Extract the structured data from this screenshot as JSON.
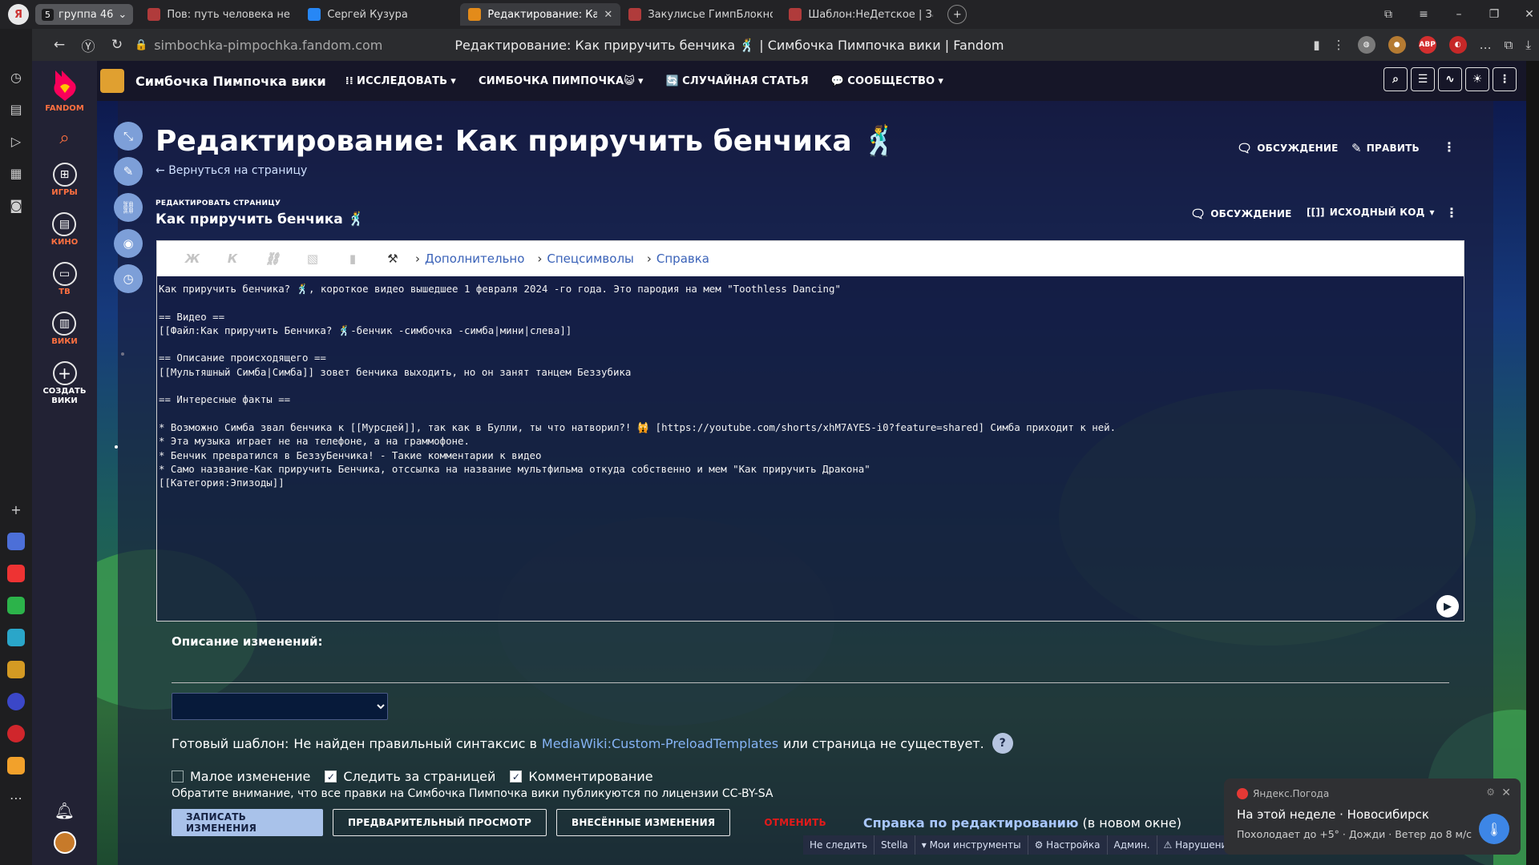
{
  "browser": {
    "group_label": "группа 46",
    "group_count": "5",
    "tabs": [
      {
        "label": "Пов: путь человека не чи",
        "active": false,
        "color": "#b03b3b"
      },
      {
        "label": "Сергей Кузура",
        "active": false,
        "color": "#2787f5"
      },
      {
        "label": "Редактирование: Как п",
        "active": true,
        "color": "#e38b1a"
      },
      {
        "label": "Закулисье ГимпБлокнота",
        "active": false,
        "color": "#b03b3b"
      },
      {
        "label": "Шаблон:НеДетское | Заку",
        "active": false,
        "color": "#b03b3b"
      }
    ],
    "url_host": "simbochka-pimpochka.fandom.com",
    "page_title": "Редактирование: Как приручить бенчика 🕺 | Симбочка Пимпочка вики | Fandom",
    "ext_abp": "ABP"
  },
  "fandom_rail": {
    "logo": "FANDOM",
    "items": [
      {
        "label": "ИГРЫ",
        "icon": "gamepad-icon"
      },
      {
        "label": "КИНО",
        "icon": "clapperboard-icon"
      },
      {
        "label": "ТВ",
        "icon": "tv-icon"
      },
      {
        "label": "ВИКИ",
        "icon": "book-icon"
      },
      {
        "label": "СОЗДАТЬ ВИКИ",
        "icon": "plus-icon"
      }
    ]
  },
  "wiki_header": {
    "name": "Симбочка Пимпочка вики",
    "nav": [
      {
        "label": "ИССЛЕДОВАТЬ",
        "prefix": "⁞⁞",
        "dropdown": true
      },
      {
        "label": "СИМБОЧКА ПИМПОЧКА😺",
        "prefix": "",
        "dropdown": true
      },
      {
        "label": "СЛУЧАЙНАЯ СТАТЬЯ",
        "prefix": "🔄",
        "dropdown": false
      },
      {
        "label": "СООБЩЕСТВО",
        "prefix": "💬",
        "dropdown": true
      }
    ]
  },
  "page": {
    "title": "Редактирование: Как приручить бенчика 🕺",
    "back_link": "Вернуться на страницу",
    "discussion": "ОБСУЖДЕНИЕ",
    "edit": "ПРАВИТЬ",
    "edit_label": "РЕДАКТИРОВАТЬ СТРАНИЦУ",
    "edit_subject": "Как приручить бенчика 🕺",
    "discussion2": "ОБСУЖДЕНИЕ",
    "source_code": "ИСХОДНЫЙ КОД"
  },
  "editor": {
    "toolbar": {
      "bold": "Ж",
      "italic": "К",
      "more": "Дополнительно",
      "special": "Спецсимволы",
      "help": "Справка"
    },
    "text": "Как приручить бенчика? 🕺, короткое видео вышедшее 1 февраля 2024 -го года. Это пародия на мем \"Toothless Dancing\"\n\n== Видео ==\n[[Файл:Как приручить Бенчика? 🕺-бенчик -симбочка -симба|мини|слева]]\n\n== Описание происходящего ==\n[[Мультяшный Симба|Симба]] зовет бенчика выходить, но он занят танцем Беззубика\n\n== Интересные факты ==\n\n* Возможно Симба звал бенчика к [[Мурсдей]], так как в Булли, ты что натворил?! 🙀 [https://youtube.com/shorts/xhM7AYES-i0?feature=shared] Симба приходит к ней.\n* Эта музыка играет не на телефоне, а на граммофоне.\n* Бенчик превратился в БеззуБенчика! - Такие комментарии к видео\n* Само название-Как приручить Бенчика, отссылка на название мультфильма откуда собственно и мем \"Как приручить Дракона\"\n[[Категория:Эпизоды]]"
  },
  "form": {
    "summary_label": "Описание изменений:",
    "template_label": "Готовый шаблон:",
    "template_msg_1": "Не найден правильный синтаксис в",
    "template_link": "MediaWiki:Custom-PreloadTemplates",
    "template_msg_2": "или страница не существует.",
    "help_q": "?",
    "minor": {
      "label": "Малое изменение",
      "checked": false
    },
    "watch": {
      "label": "Следить за страницей",
      "checked": true
    },
    "comment": {
      "label": "Комментирование",
      "checked": true
    },
    "license": "Обратите внимание, что все правки на Симбочка Пимпочка вики публикуются по лицензии CC-BY-SA",
    "save": "ЗАПИСАТЬ ИЗМЕНЕНИЯ",
    "preview": "ПРЕДВАРИТЕЛЬНЫЙ ПРОСМОТР",
    "changes": "ВНЕСЁННЫЕ ИЗМЕНЕНИЯ",
    "cancel": "ОТМЕНИТЬ",
    "help_edit": "Справка по редактированию",
    "help_edit_suffix": "(в новом окне)"
  },
  "tools_bar": [
    "Не следить",
    "Stella",
    "▾ Мои инструменты",
    "⚙ Настройка",
    "Админ.",
    "⚠ Нарушения"
  ],
  "weather": {
    "source": "Яндекс.Погода",
    "title": "На этой неделе · Новосибирск",
    "desc": "Похолодает до +5° · Дожди · Ветер до 8 м/с"
  }
}
